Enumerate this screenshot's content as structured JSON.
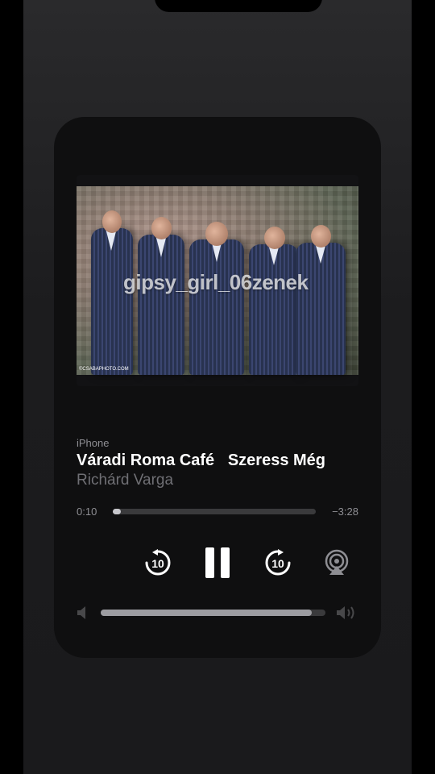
{
  "now_playing": {
    "source": "iPhone",
    "title": "Váradi Roma Café   Szeress Még",
    "artist": "Richárd Varga",
    "elapsed": "0:10",
    "remaining": "−3:28",
    "progress": 0.04,
    "volume": 0.94
  },
  "artwork": {
    "watermark": "gipsy_girl_06zenek",
    "credit": "©CSABAPHOTO.COM"
  },
  "controls": {
    "skip_back_seconds": "10",
    "skip_forward_seconds": "10"
  },
  "icons": [
    "skip-back-10-icon",
    "pause-icon",
    "skip-forward-10-icon",
    "airplay-icon",
    "volume-low-icon",
    "volume-high-icon"
  ],
  "colors": {
    "background": "#1c1c1e",
    "card": "#0f0f10",
    "primary_text": "#ffffff",
    "secondary_text": "#8e8e93",
    "track": "#3a3a3c"
  }
}
